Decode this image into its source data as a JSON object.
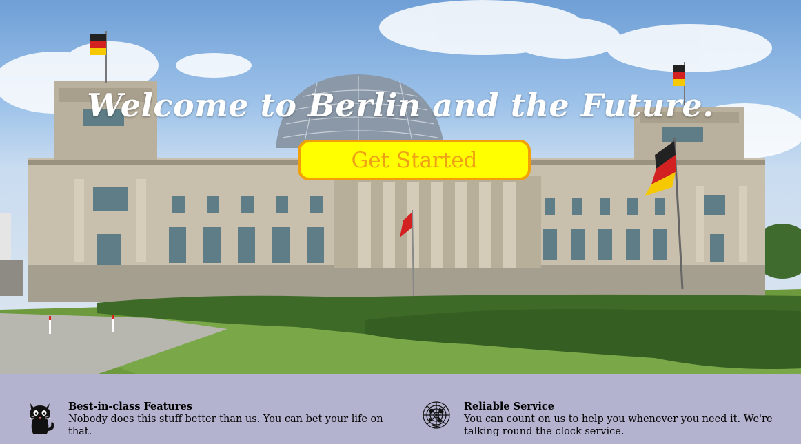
{
  "hero": {
    "title": "Welcome to Berlin and the Future.",
    "cta_label": "Get Started"
  },
  "features": [
    {
      "icon": "cat-icon",
      "title": "Best-in-class Features",
      "description": "Nobody does this stuff better than us. You can bet your life on that."
    },
    {
      "icon": "globe-map-icon",
      "title": "Reliable Service",
      "description": "You can count on us to help you whenever you need it. We're talking round the clock service."
    }
  ],
  "colors": {
    "cta_background": "#ffff00",
    "cta_border": "#f2a007",
    "cta_text": "#f0a015",
    "features_background": "#b3b2cf"
  }
}
